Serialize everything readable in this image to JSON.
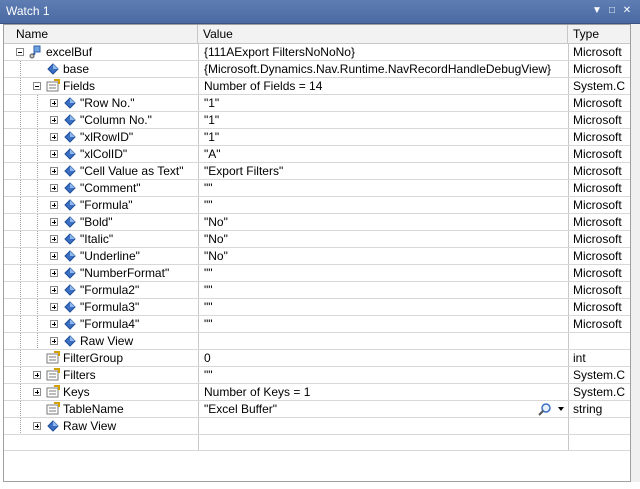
{
  "window": {
    "title": "Watch 1"
  },
  "columns": {
    "name": "Name",
    "value": "Value",
    "type": "Type"
  },
  "rows": [
    {
      "name": "excelBuf",
      "value": "{111AExport FiltersNoNoNo}",
      "type": "Microsoft",
      "level": 0,
      "expander": "minus",
      "icon": "class-icon"
    },
    {
      "name": "base",
      "value": "{Microsoft.Dynamics.Nav.Runtime.NavRecordHandleDebugView}",
      "type": "Microsoft",
      "level": 1,
      "expander": "none",
      "icon": "field-icon"
    },
    {
      "name": "Fields",
      "value": "Number of Fields = 14",
      "type": "System.C",
      "level": 1,
      "expander": "minus",
      "icon": "property-icon"
    },
    {
      "name": "\"Row No.\"",
      "value": "\"1\"",
      "type": "Microsoft",
      "level": 2,
      "expander": "plus",
      "icon": "field-icon"
    },
    {
      "name": "\"Column No.\"",
      "value": "\"1\"",
      "type": "Microsoft",
      "level": 2,
      "expander": "plus",
      "icon": "field-icon"
    },
    {
      "name": "\"xlRowID\"",
      "value": "\"1\"",
      "type": "Microsoft",
      "level": 2,
      "expander": "plus",
      "icon": "field-icon"
    },
    {
      "name": "\"xlColID\"",
      "value": "\"A\"",
      "type": "Microsoft",
      "level": 2,
      "expander": "plus",
      "icon": "field-icon"
    },
    {
      "name": "\"Cell Value as Text\"",
      "value": "\"Export Filters\"",
      "type": "Microsoft",
      "level": 2,
      "expander": "plus",
      "icon": "field-icon"
    },
    {
      "name": "\"Comment\"",
      "value": "\"\"",
      "type": "Microsoft",
      "level": 2,
      "expander": "plus",
      "icon": "field-icon"
    },
    {
      "name": "\"Formula\"",
      "value": "\"\"",
      "type": "Microsoft",
      "level": 2,
      "expander": "plus",
      "icon": "field-icon"
    },
    {
      "name": "\"Bold\"",
      "value": "\"No\"",
      "type": "Microsoft",
      "level": 2,
      "expander": "plus",
      "icon": "field-icon"
    },
    {
      "name": "\"Italic\"",
      "value": "\"No\"",
      "type": "Microsoft",
      "level": 2,
      "expander": "plus",
      "icon": "field-icon"
    },
    {
      "name": "\"Underline\"",
      "value": "\"No\"",
      "type": "Microsoft",
      "level": 2,
      "expander": "plus",
      "icon": "field-icon"
    },
    {
      "name": "\"NumberFormat\"",
      "value": "\"\"",
      "type": "Microsoft",
      "level": 2,
      "expander": "plus",
      "icon": "field-icon"
    },
    {
      "name": "\"Formula2\"",
      "value": "\"\"",
      "type": "Microsoft",
      "level": 2,
      "expander": "plus",
      "icon": "field-icon"
    },
    {
      "name": "\"Formula3\"",
      "value": "\"\"",
      "type": "Microsoft",
      "level": 2,
      "expander": "plus",
      "icon": "field-icon"
    },
    {
      "name": "\"Formula4\"",
      "value": "\"\"",
      "type": "Microsoft",
      "level": 2,
      "expander": "plus",
      "icon": "field-icon"
    },
    {
      "name": "Raw View",
      "value": "",
      "type": "",
      "level": 2,
      "expander": "plus",
      "icon": "field-icon"
    },
    {
      "name": "FilterGroup",
      "value": "0",
      "type": "int",
      "level": 1,
      "expander": "none",
      "icon": "property-icon"
    },
    {
      "name": "Filters",
      "value": "\"\"",
      "type": "System.C",
      "level": 1,
      "expander": "plus",
      "icon": "property-icon"
    },
    {
      "name": "Keys",
      "value": "Number of Keys = 1",
      "type": "System.C",
      "level": 1,
      "expander": "plus",
      "icon": "property-icon"
    },
    {
      "name": "TableName",
      "value": "\"Excel Buffer\"",
      "type": "string",
      "level": 1,
      "expander": "none",
      "icon": "property-icon",
      "visualizer": true
    },
    {
      "name": "Raw View",
      "value": "",
      "type": "",
      "level": 1,
      "expander": "plus",
      "icon": "field-icon"
    }
  ],
  "icons": {
    "class": "class-icon",
    "field": "field-icon",
    "property": "property-icon",
    "visualizer": "search-icon"
  },
  "colors": {
    "titlebar": "#4b6aa3",
    "field_icon": "#3a6fc4",
    "property_icon": "#d4a000"
  }
}
